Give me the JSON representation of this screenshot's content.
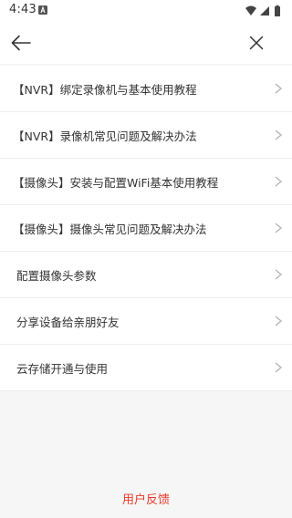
{
  "status_bar": {
    "time": "4:43"
  },
  "app_bar": {
    "back_icon": "arrow-left-icon",
    "close_icon": "close-icon"
  },
  "help_items": [
    {
      "label": "【NVR】绑定录像机与基本使用教程"
    },
    {
      "label": "【NVR】录像机常见问题及解决办法"
    },
    {
      "label": "【摄像头】安装与配置WiFi基本使用教程"
    },
    {
      "label": "【摄像头】摄像头常见问题及解决办法"
    },
    {
      "label": "配置摄像头参数"
    },
    {
      "label": "分享设备给亲朋好友"
    },
    {
      "label": "云存储开通与使用"
    }
  ],
  "footer": {
    "feedback_label": "用户反馈"
  },
  "colors": {
    "accent": "#e9392b",
    "text": "#333333",
    "chevron": "#b5b5b5",
    "background": "#f6f6f6"
  }
}
